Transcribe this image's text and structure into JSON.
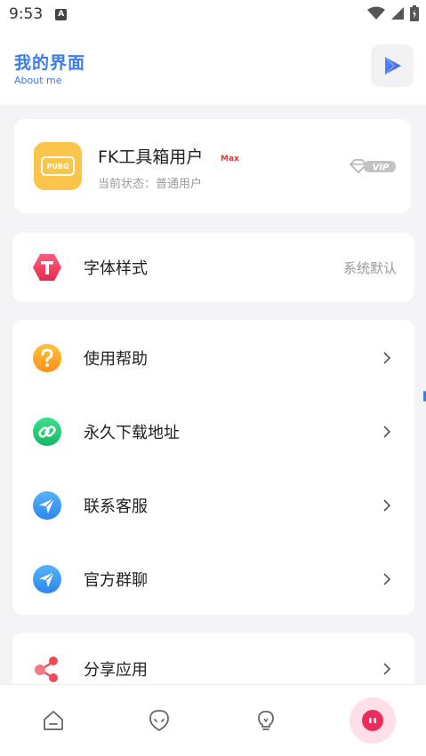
{
  "status_bar": {
    "time": "9:53",
    "notification_letter": "A"
  },
  "header": {
    "title": "我的界面",
    "subtitle": "About me",
    "action_icon": "play-icon"
  },
  "user_card": {
    "app_icon_text": "PUBG",
    "name": "FK工具箱用户",
    "badge": "Max",
    "status": "当前状态：普通用户",
    "vip_label": "VIP"
  },
  "font_setting": {
    "label": "字体样式",
    "value": "系统默认",
    "icon": "font-t-icon"
  },
  "menu": {
    "items": [
      {
        "label": "使用帮助",
        "icon": "help-icon"
      },
      {
        "label": "永久下载地址",
        "icon": "link-icon"
      },
      {
        "label": "联系客服",
        "icon": "send-icon"
      },
      {
        "label": "官方群聊",
        "icon": "send-icon"
      }
    ]
  },
  "share": {
    "label": "分享应用",
    "icon": "share-icon"
  },
  "bottom_nav": {
    "items": [
      {
        "name": "home-icon"
      },
      {
        "name": "alien-icon"
      },
      {
        "name": "bulb-icon"
      },
      {
        "name": "profile-icon",
        "active": true
      }
    ]
  },
  "colors": {
    "accent": "#3d7be8",
    "badge_red": "#e53535",
    "app_icon_bg": "#fbc54c",
    "active_nav_bg": "#fde0e8"
  }
}
